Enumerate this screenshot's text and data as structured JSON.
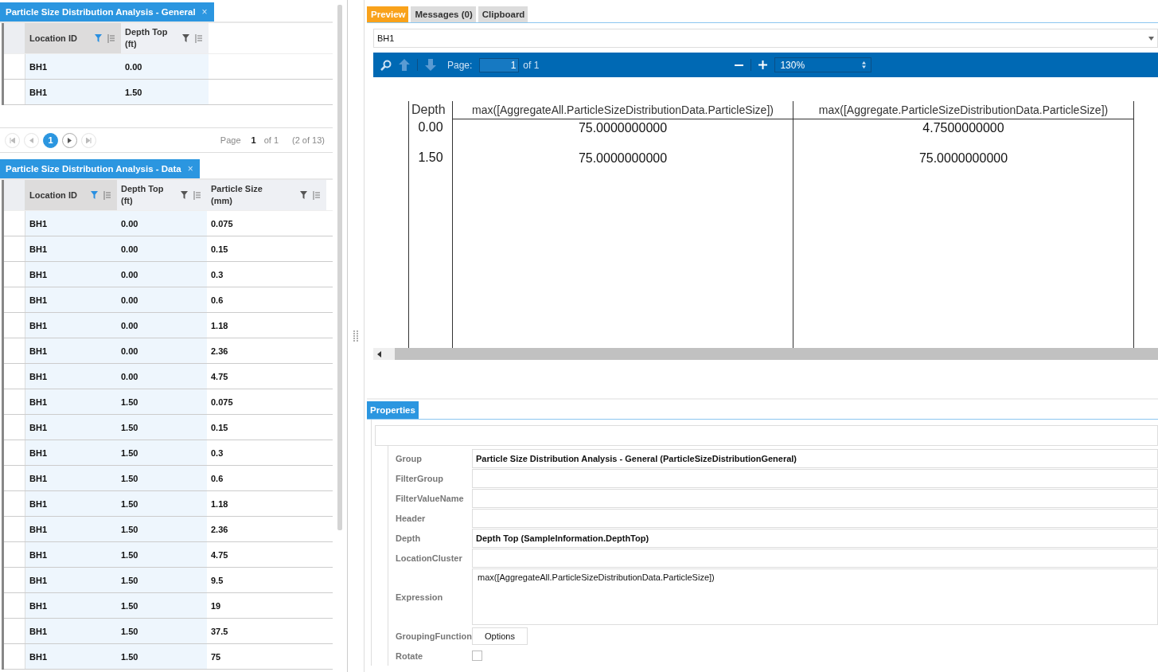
{
  "general_grid": {
    "tab": {
      "title": "Particle Size Distribution Analysis - General",
      "close": "×"
    },
    "columns": [
      {
        "label": "Location ID",
        "filtered": true,
        "shaded": true
      },
      {
        "label": "Depth Top (ft)",
        "filtered": false,
        "shaded": true
      }
    ],
    "rows": [
      [
        "BH1",
        "0.00"
      ],
      [
        "BH1",
        "1.50"
      ]
    ],
    "pager": {
      "pages": [
        {
          "label": "1",
          "selected": true
        }
      ],
      "page_label": "Page",
      "page": "1",
      "of": "of 1",
      "count": "(2 of 13)"
    }
  },
  "data_grid": {
    "tab": {
      "title": "Particle Size Distribution Analysis - Data",
      "close": "×"
    },
    "columns": [
      {
        "label": "Location ID",
        "filtered": true,
        "shaded": true
      },
      {
        "label": "Depth Top (ft)",
        "filtered": false,
        "shaded": true
      },
      {
        "label": "Particle Size (mm)",
        "filtered": false,
        "shaded": false
      }
    ],
    "rows": [
      [
        "BH1",
        "0.00",
        "0.075"
      ],
      [
        "BH1",
        "0.00",
        "0.15"
      ],
      [
        "BH1",
        "0.00",
        "0.3"
      ],
      [
        "BH1",
        "0.00",
        "0.6"
      ],
      [
        "BH1",
        "0.00",
        "1.18"
      ],
      [
        "BH1",
        "0.00",
        "2.36"
      ],
      [
        "BH1",
        "0.00",
        "4.75"
      ],
      [
        "BH1",
        "1.50",
        "0.075"
      ],
      [
        "BH1",
        "1.50",
        "0.15"
      ],
      [
        "BH1",
        "1.50",
        "0.3"
      ],
      [
        "BH1",
        "1.50",
        "0.6"
      ],
      [
        "BH1",
        "1.50",
        "1.18"
      ],
      [
        "BH1",
        "1.50",
        "2.36"
      ],
      [
        "BH1",
        "1.50",
        "4.75"
      ],
      [
        "BH1",
        "1.50",
        "9.5"
      ],
      [
        "BH1",
        "1.50",
        "19"
      ],
      [
        "BH1",
        "1.50",
        "37.5"
      ],
      [
        "BH1",
        "1.50",
        "75"
      ]
    ]
  },
  "preview": {
    "tabs": [
      {
        "label": "Preview",
        "selected": true
      },
      {
        "label": "Messages (0)",
        "selected": false
      },
      {
        "label": "Clipboard",
        "selected": false
      }
    ],
    "location": "BH1",
    "toolbar": {
      "page_label": "Page:",
      "page": "1",
      "of": "of 1",
      "zoom": "130%"
    },
    "report": {
      "columns": [
        "Depth",
        "max([AggregateAll.ParticleSizeDistributionData.ParticleSize])",
        "max([Aggregate.ParticleSizeDistributionData.ParticleSize])"
      ],
      "rows": [
        [
          "0.00",
          "75.0000000000",
          "4.7500000000"
        ],
        [
          "1.50",
          "75.0000000000",
          "75.0000000000"
        ]
      ]
    }
  },
  "properties": {
    "tab": "Properties",
    "rows": [
      {
        "kind": "text",
        "label": "Group",
        "value": "Particle Size Distribution Analysis - General (ParticleSizeDistributionGeneral)"
      },
      {
        "kind": "text",
        "label": "FilterGroup"
      },
      {
        "kind": "text",
        "label": "FilterValueName"
      },
      {
        "kind": "text",
        "label": "Header"
      },
      {
        "kind": "text",
        "label": "Depth",
        "value": "Depth Top (SampleInformation.DepthTop)"
      },
      {
        "kind": "text",
        "label": "LocationCluster"
      },
      {
        "kind": "multiline",
        "label": "Expression",
        "value": "max([AggregateAll.ParticleSizeDistributionData.ParticleSize])"
      },
      {
        "kind": "button",
        "label": "GroupingFunction",
        "value": "Options"
      },
      {
        "kind": "checkbox",
        "label": "Rotate",
        "checked": false
      }
    ]
  }
}
